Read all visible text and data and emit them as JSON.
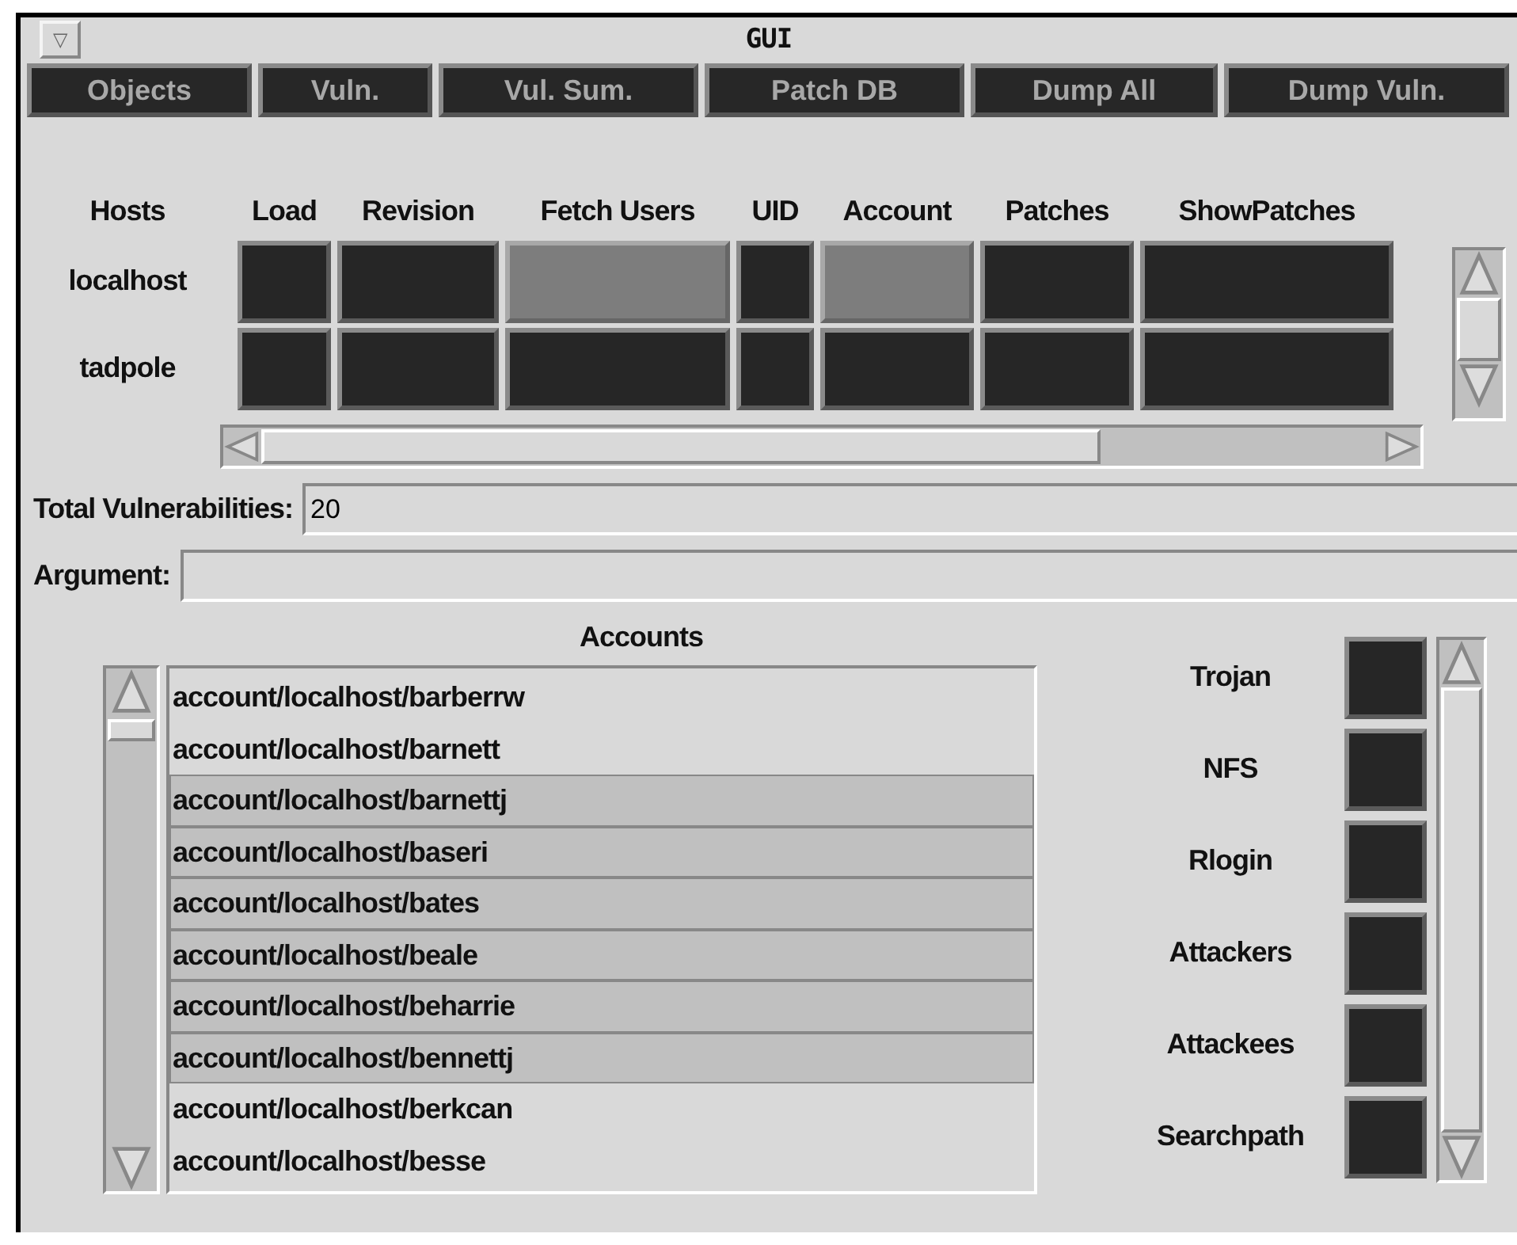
{
  "window": {
    "title": "GUI",
    "menu_glyph": "▽"
  },
  "buttons": [
    "Objects",
    "Vuln.",
    "Vul. Sum.",
    "Patch DB",
    "Dump All",
    "Dump Vuln."
  ],
  "host_table": {
    "columns": [
      "Hosts",
      "Load",
      "Revision",
      "Fetch Users",
      "UID",
      "Account",
      "Patches",
      "ShowPatches"
    ],
    "rows": [
      {
        "host": "localhost",
        "cells": [
          {
            "active": false
          },
          {
            "active": false
          },
          {
            "active": true
          },
          {
            "active": false
          },
          {
            "active": true
          },
          {
            "active": false
          },
          {
            "active": false
          }
        ]
      },
      {
        "host": "tadpole",
        "cells": [
          {
            "active": false
          },
          {
            "active": false
          },
          {
            "active": false
          },
          {
            "active": false
          },
          {
            "active": false
          },
          {
            "active": false
          },
          {
            "active": false
          }
        ]
      }
    ]
  },
  "fields": [
    {
      "label": "Total Vulnerabilities:",
      "value": "20"
    },
    {
      "label": "Argument:"
    }
  ],
  "accounts": {
    "title": "Accounts",
    "items": [
      {
        "text": "account/localhost/barberrw",
        "selected": false
      },
      {
        "text": "account/localhost/barnett",
        "selected": false
      },
      {
        "text": "account/localhost/barnettj",
        "selected": true
      },
      {
        "text": "account/localhost/baseri",
        "selected": true
      },
      {
        "text": "account/localhost/bates",
        "selected": true
      },
      {
        "text": "account/localhost/beale",
        "selected": true
      },
      {
        "text": "account/localhost/beharrie",
        "selected": true
      },
      {
        "text": "account/localhost/bennettj",
        "selected": true
      },
      {
        "text": "account/localhost/berkcan",
        "selected": false
      },
      {
        "text": "account/localhost/besse",
        "selected": false
      }
    ]
  },
  "toggles": [
    {
      "label": "Trojan",
      "on": false
    },
    {
      "label": "NFS",
      "on": false
    },
    {
      "label": "Rlogin",
      "on": false
    },
    {
      "label": "Attackers",
      "on": false
    },
    {
      "label": "Attackees",
      "on": false
    },
    {
      "label": "Searchpath",
      "on": false
    }
  ]
}
